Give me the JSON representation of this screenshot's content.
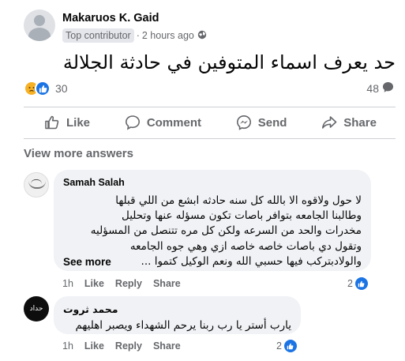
{
  "post": {
    "author": "Makaruos K. Gaid",
    "badge": "Top contributor",
    "separator": "·",
    "time": "2 hours ago",
    "text": "حد يعرف اسماء المتوفين في حادثة الجلالة",
    "reaction_count": "30",
    "comment_count": "48"
  },
  "actions": {
    "like": "Like",
    "comment": "Comment",
    "send": "Send",
    "share": "Share"
  },
  "view_more": "View more answers",
  "comments": [
    {
      "name": "Samah Salah",
      "lines": [
        "لا حول ولاقوه الا بالله كل سنه حادثه ابشع من اللي قبلها",
        "وطالبنا الجامعه بتوافر باصات تكون مسؤله عنها وتحليل",
        "مخدرات والحد من السرعه ولكن كل مره تتنصل من المسؤليه",
        "وتقول دي باصات خاصه خاصه ازي وهي جوه الجامعه",
        "والولادبتركب فيها حسبي الله ونعم الوكيل كتموا ..."
      ],
      "see_more": "See more",
      "time": "1h",
      "like": "Like",
      "reply": "Reply",
      "share": "Share",
      "likes": "2"
    },
    {
      "name": "محمد ثروت",
      "avatar_text": "حداد",
      "lines": [
        "يارب أستر يا رب ربنا يرحم الشهداء ويصبر اهليهم"
      ],
      "time": "1h",
      "like": "Like",
      "reply": "Reply",
      "share": "Share",
      "likes": "2"
    }
  ],
  "colors": {
    "accent": "#1b74e4",
    "secondary_text": "#65676b",
    "bubble_bg": "#f0f2f5",
    "sad_reaction": "#f7b125"
  },
  "icons": [
    "default-avatar-icon",
    "globe-icon",
    "sad-reaction-icon",
    "like-reaction-icon",
    "comment-bubble-icon",
    "thumbs-up-icon",
    "comment-icon",
    "messenger-icon",
    "share-arrow-icon"
  ]
}
